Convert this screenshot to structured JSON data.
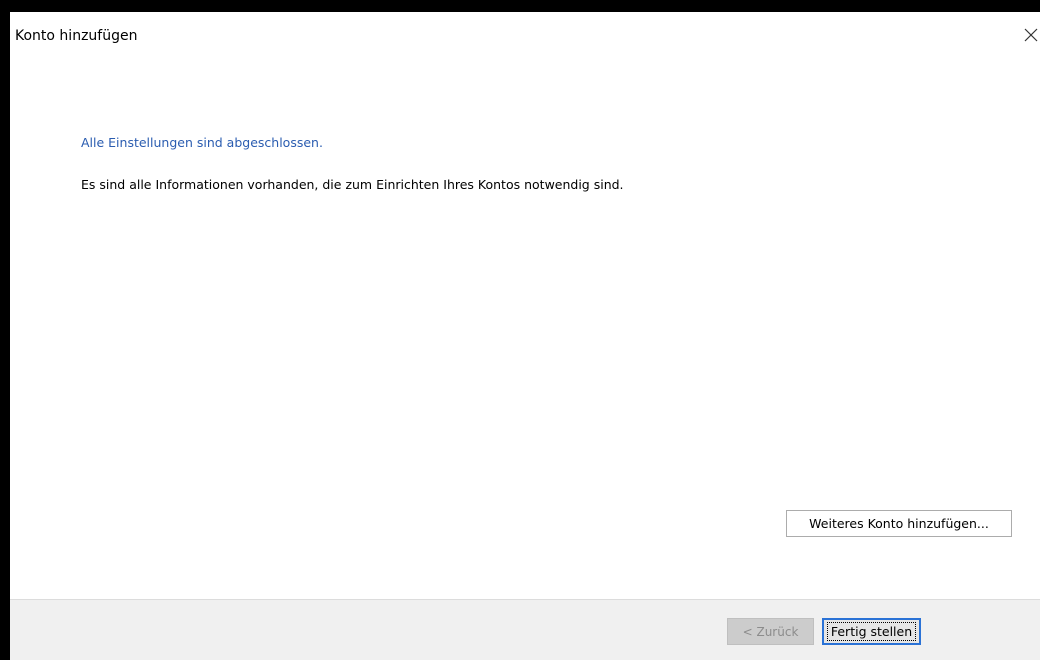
{
  "window": {
    "title": "Konto hinzufügen"
  },
  "content": {
    "heading": "Alle Einstellungen sind abgeschlossen.",
    "description": "Es sind alle Informationen vorhanden, die zum Einrichten Ihres Kontos notwendig sind.",
    "add_account_label": "Weiteres Konto hinzufügen..."
  },
  "footer": {
    "back_label": "< Zurück",
    "finish_label": "Fertig stellen"
  },
  "icons": {
    "close": "close-icon"
  },
  "colors": {
    "heading": "#2a5cb0",
    "footer_bg": "#f0f0f0",
    "focus_border": "#2a72d6"
  }
}
